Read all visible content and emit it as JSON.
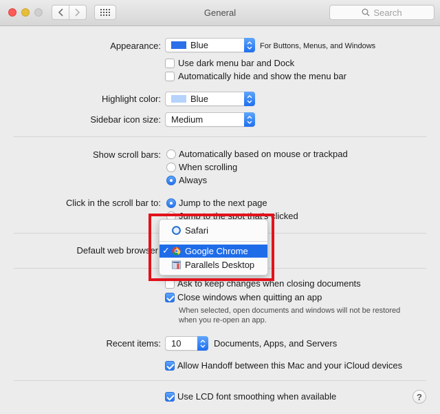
{
  "window": {
    "title": "General",
    "search_placeholder": "Search"
  },
  "appearance": {
    "label": "Appearance:",
    "value": "Blue",
    "swatch_color": "#2b6fe9",
    "note": "For Buttons, Menus, and Windows",
    "dark_menu_label": "Use dark menu bar and Dock",
    "dark_menu_checked": false,
    "autohide_label": "Automatically hide and show the menu bar",
    "autohide_checked": false
  },
  "highlight": {
    "label": "Highlight color:",
    "value": "Blue",
    "swatch_color": "#b5d3fb"
  },
  "sidebar_icon": {
    "label": "Sidebar icon size:",
    "value": "Medium"
  },
  "scroll_bars": {
    "label": "Show scroll bars:",
    "options": [
      "Automatically based on mouse or trackpad",
      "When scrolling",
      "Always"
    ],
    "selected": "Always"
  },
  "click_scroll": {
    "label": "Click in the scroll bar to:",
    "options": [
      "Jump to the next page",
      "Jump to the spot that's clicked"
    ],
    "selected": "Jump to the next page"
  },
  "browser": {
    "label": "Default web browser",
    "menu": [
      {
        "label": "Safari",
        "icon": "safari-icon",
        "checked": false
      },
      {
        "label": "Google Chrome",
        "icon": "chrome-icon",
        "checked": true
      },
      {
        "label": "Parallels Desktop",
        "icon": "parallels-icon",
        "checked": false
      }
    ],
    "checkmark": "✓",
    "highlight_color": "#e2121b"
  },
  "documents": {
    "ask_label": "Ask to keep changes when closing documents",
    "ask_checked": false,
    "close_label": "Close windows when quitting an app",
    "close_checked": true,
    "close_note_line1": "When selected, open documents and windows will not be restored",
    "close_note_line2": "when you re-open an app."
  },
  "recent": {
    "label": "Recent items:",
    "value": "10",
    "note": "Documents, Apps, and Servers"
  },
  "handoff": {
    "label": "Allow Handoff between this Mac and your iCloud devices",
    "checked": true
  },
  "lcd": {
    "label": "Use LCD font smoothing when available",
    "checked": true
  },
  "help": {
    "label": "?"
  }
}
